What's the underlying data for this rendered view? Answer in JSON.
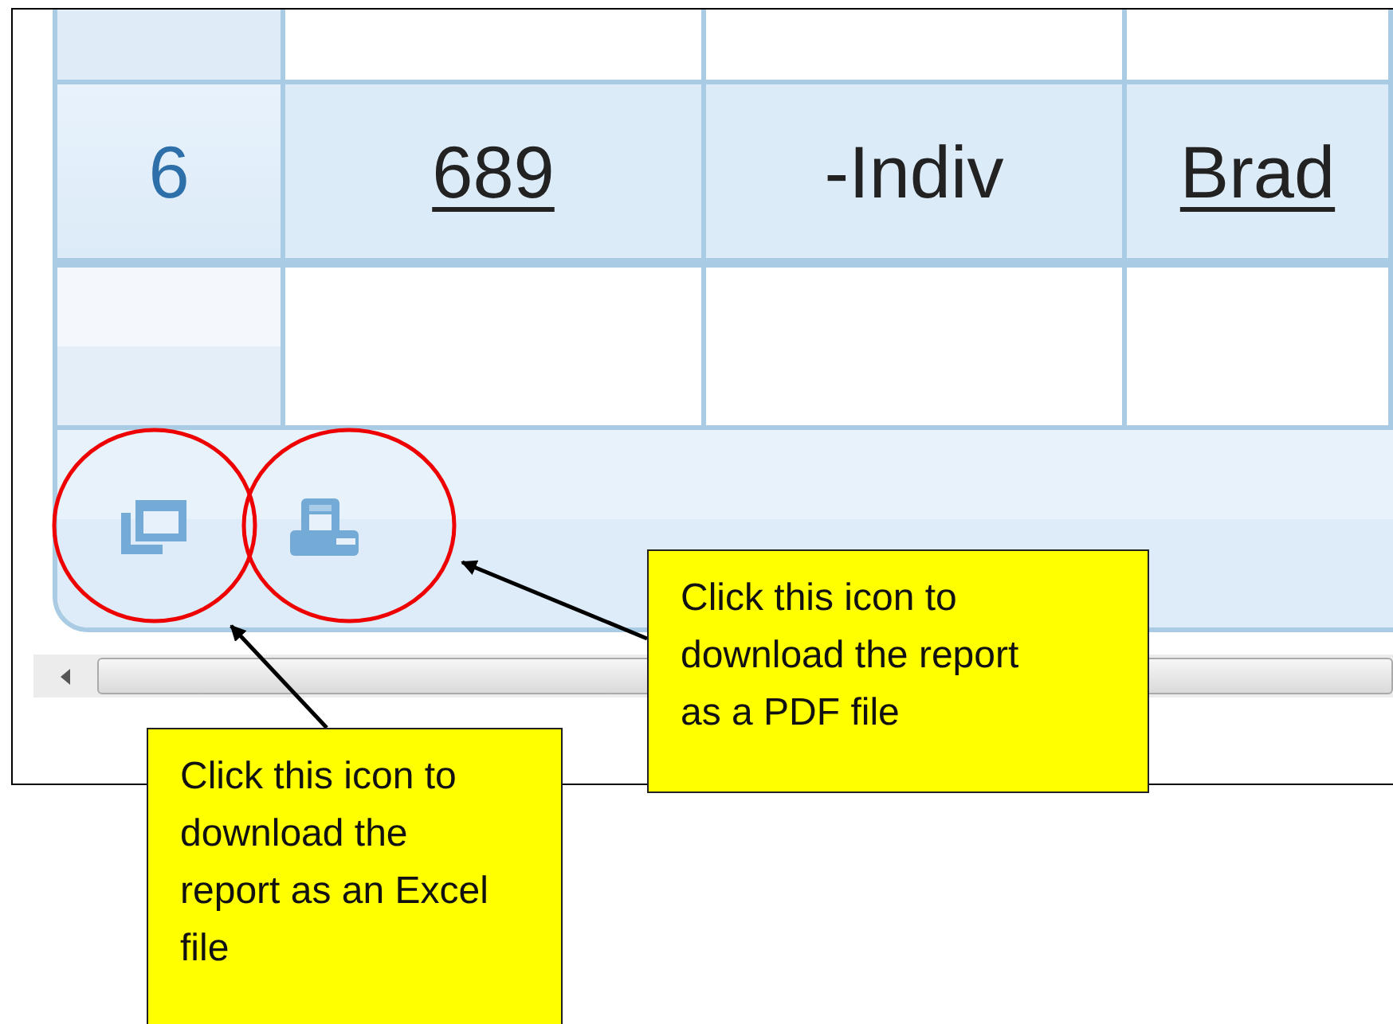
{
  "table": {
    "rows": [
      {
        "kind": "cut",
        "cells": []
      },
      {
        "kind": "data",
        "cells": [
          {
            "text": "6",
            "link": false
          },
          {
            "text": "689",
            "link": true
          },
          {
            "text": "-Indiv",
            "link": false
          },
          {
            "text": "Brad",
            "link": true
          }
        ]
      },
      {
        "kind": "blank",
        "cells": []
      }
    ]
  },
  "footer": {
    "icons": [
      {
        "kind": "excel"
      },
      {
        "kind": "pdf"
      }
    ]
  },
  "callouts": [
    {
      "text": "Click this icon to download the report as a PDF file"
    },
    {
      "text": "Click this icon to download the report as an Excel file"
    }
  ]
}
